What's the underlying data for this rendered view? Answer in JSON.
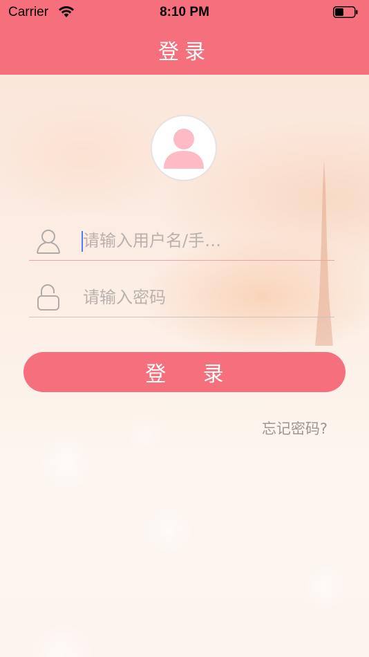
{
  "status_bar": {
    "carrier": "Carrier",
    "time": "8:10 PM"
  },
  "nav": {
    "title": "登录"
  },
  "form": {
    "username_placeholder": "请输入用户名/手…",
    "password_placeholder": "请输入密码",
    "login_button": "登 录",
    "forgot_password": "忘记密码?"
  },
  "icons": {
    "avatar": "person-icon",
    "username": "user-outline-icon",
    "password": "lock-outline-icon",
    "wifi": "wifi-icon",
    "battery": "battery-icon"
  },
  "colors": {
    "accent": "#f56f7c",
    "avatar_fill": "#fdbcc5",
    "placeholder": "#b9b1ae",
    "link": "#9c9593"
  }
}
